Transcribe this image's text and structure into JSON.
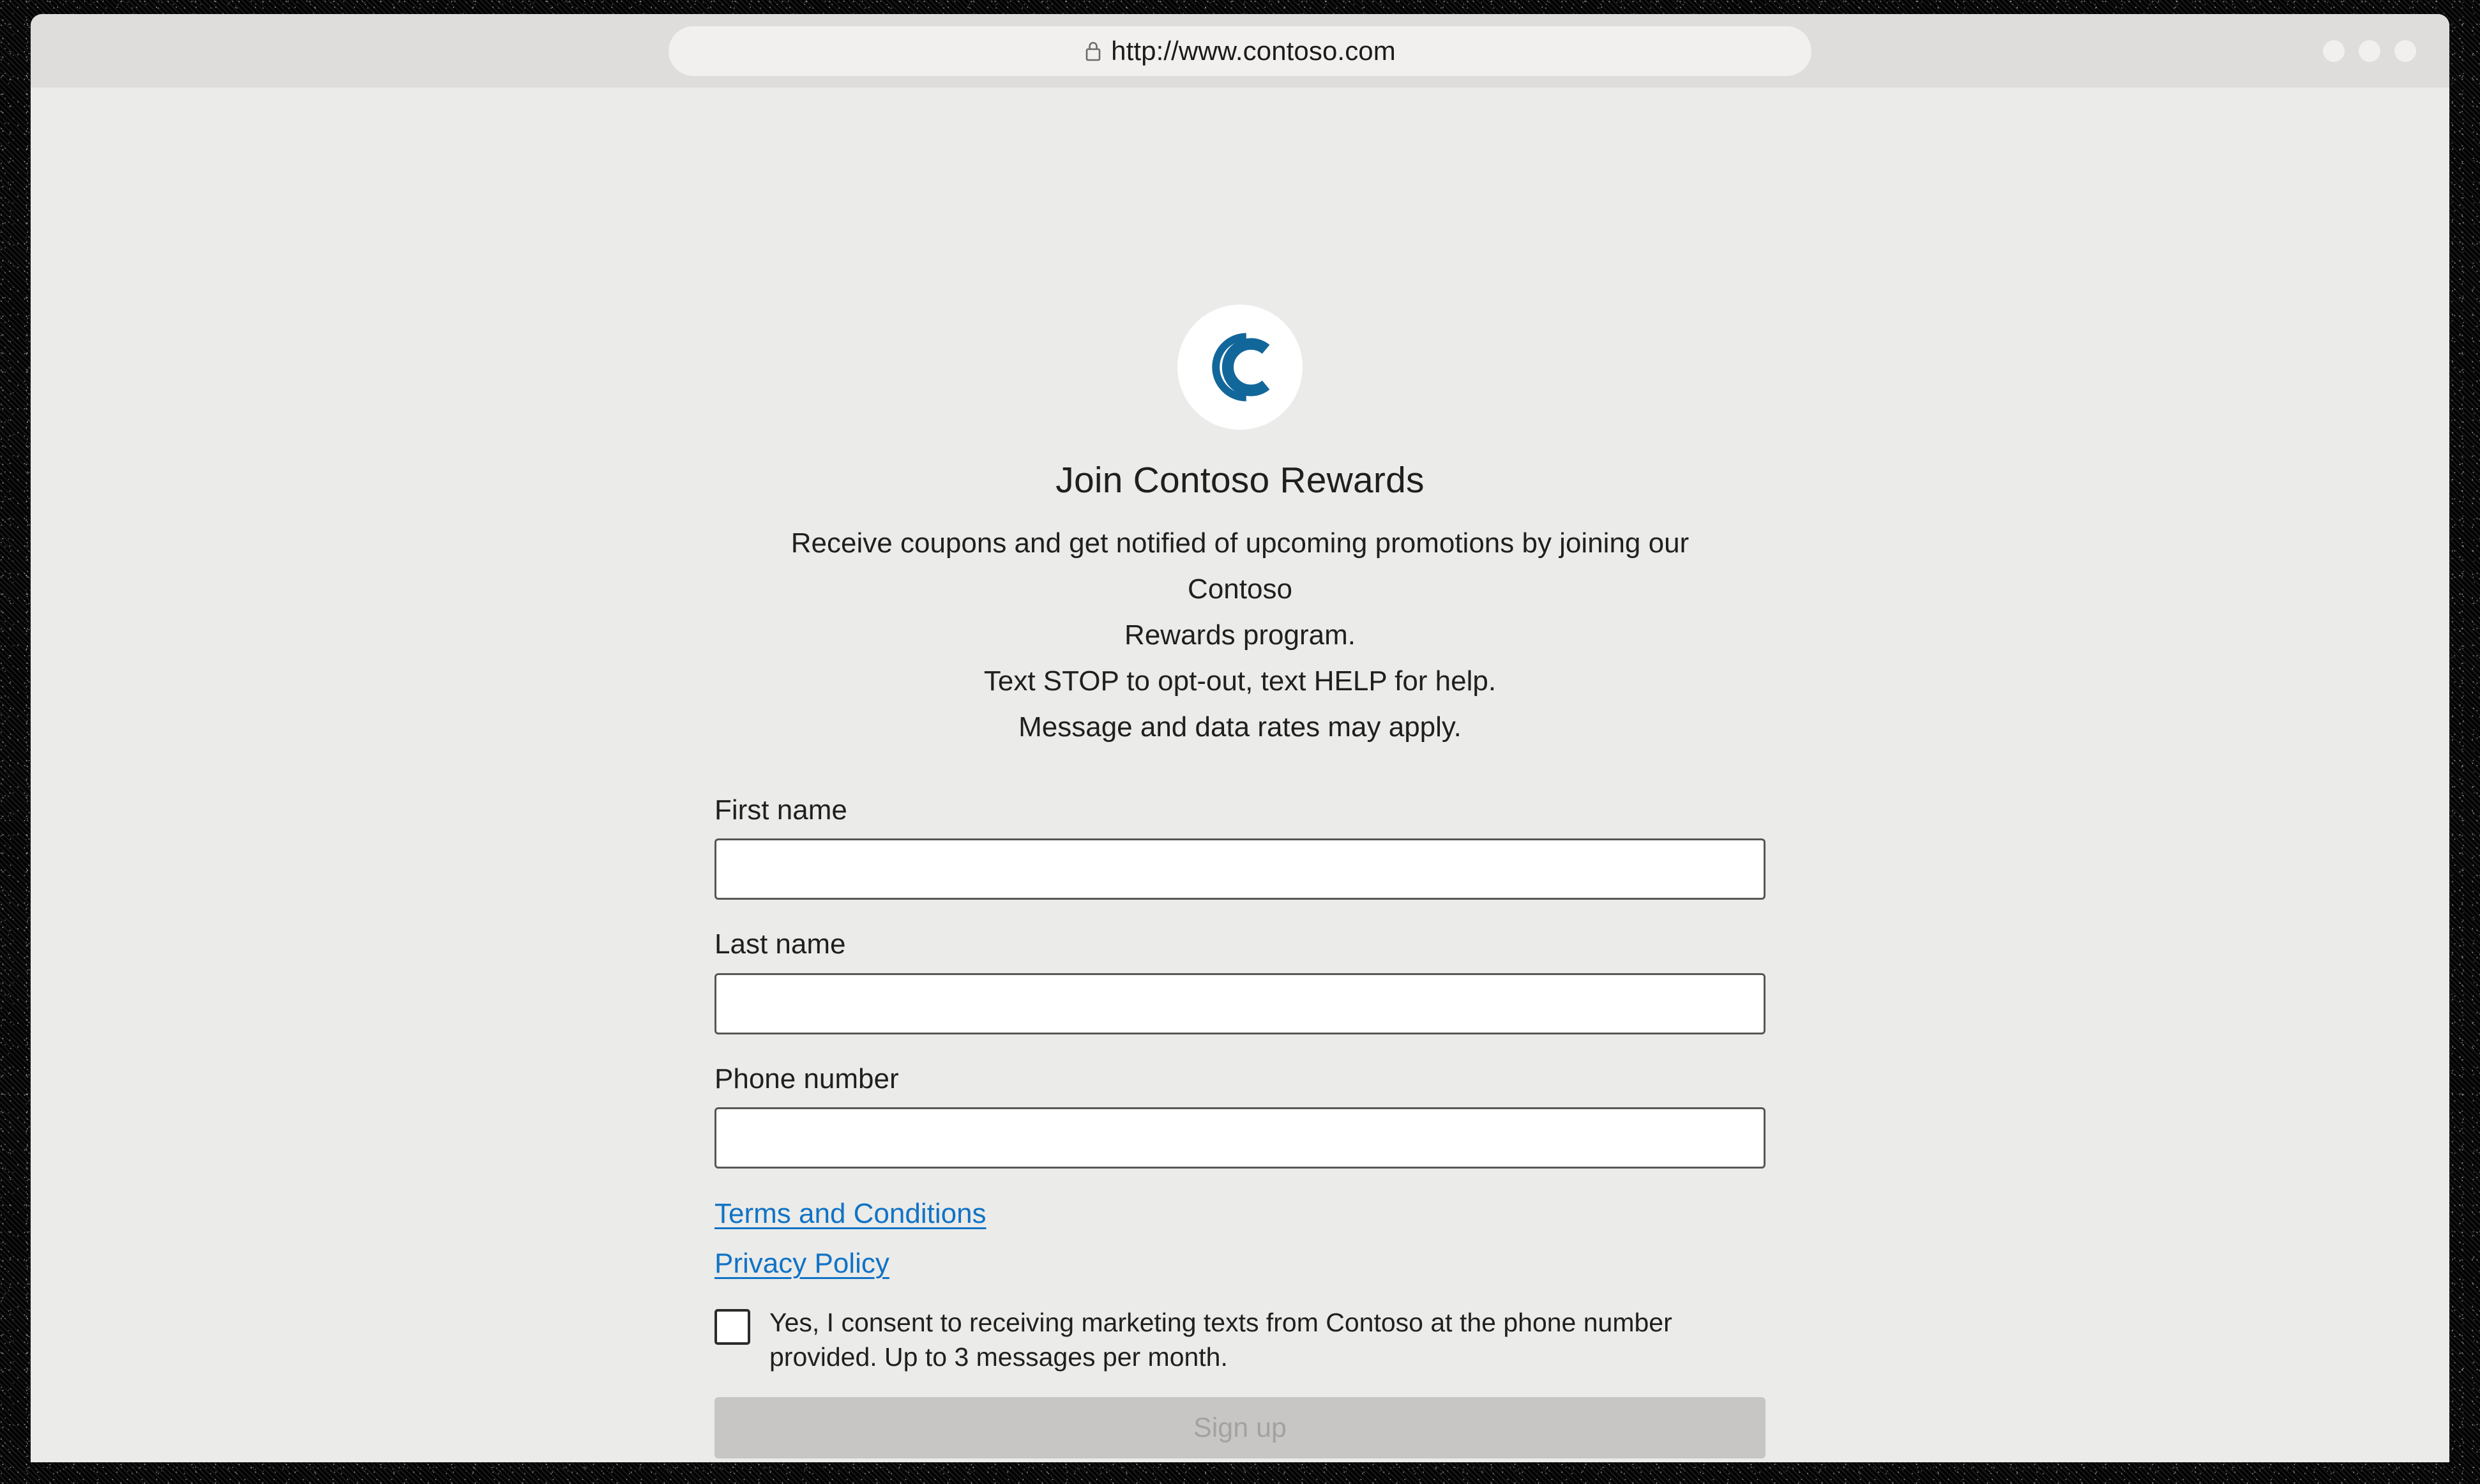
{
  "browser": {
    "url": "http://www.contoso.com",
    "lock_icon": "lock-icon",
    "window_dots": [
      "minimize-dot",
      "maximize-dot",
      "close-dot"
    ]
  },
  "brand": {
    "logo_icon": "contoso-c-logo",
    "logo_color": "#12679A",
    "logo_background": "#FFFFFF"
  },
  "page": {
    "title": "Join Contoso Rewards",
    "intro_line_1": "Receive coupons and get notified of upcoming promotions by joining our Contoso",
    "intro_line_2": "Rewards program.",
    "intro_line_3": "Text STOP to opt-out, text HELP for help.",
    "intro_line_4": "Message and data rates may apply.",
    "background": "#EBEBE9",
    "text_color": "#1F1F1F"
  },
  "form": {
    "fields": [
      {
        "label": "First name",
        "value": "",
        "placeholder": ""
      },
      {
        "label": "Last name",
        "value": "",
        "placeholder": ""
      },
      {
        "label": "Phone number",
        "value": "",
        "placeholder": ""
      }
    ],
    "links": [
      {
        "label": "Terms and Conditions",
        "color": "#1073C6"
      },
      {
        "label": "Privacy Policy",
        "color": "#1073C6"
      }
    ],
    "consent": {
      "checked": false,
      "text": "Yes, I consent to receiving marketing texts from Contoso at the phone number provided. Up to 3 messages per month."
    },
    "submit": {
      "label": "Sign up",
      "enabled": false,
      "background": "#C7C6C4",
      "text_color": "#A3A2A0"
    }
  }
}
